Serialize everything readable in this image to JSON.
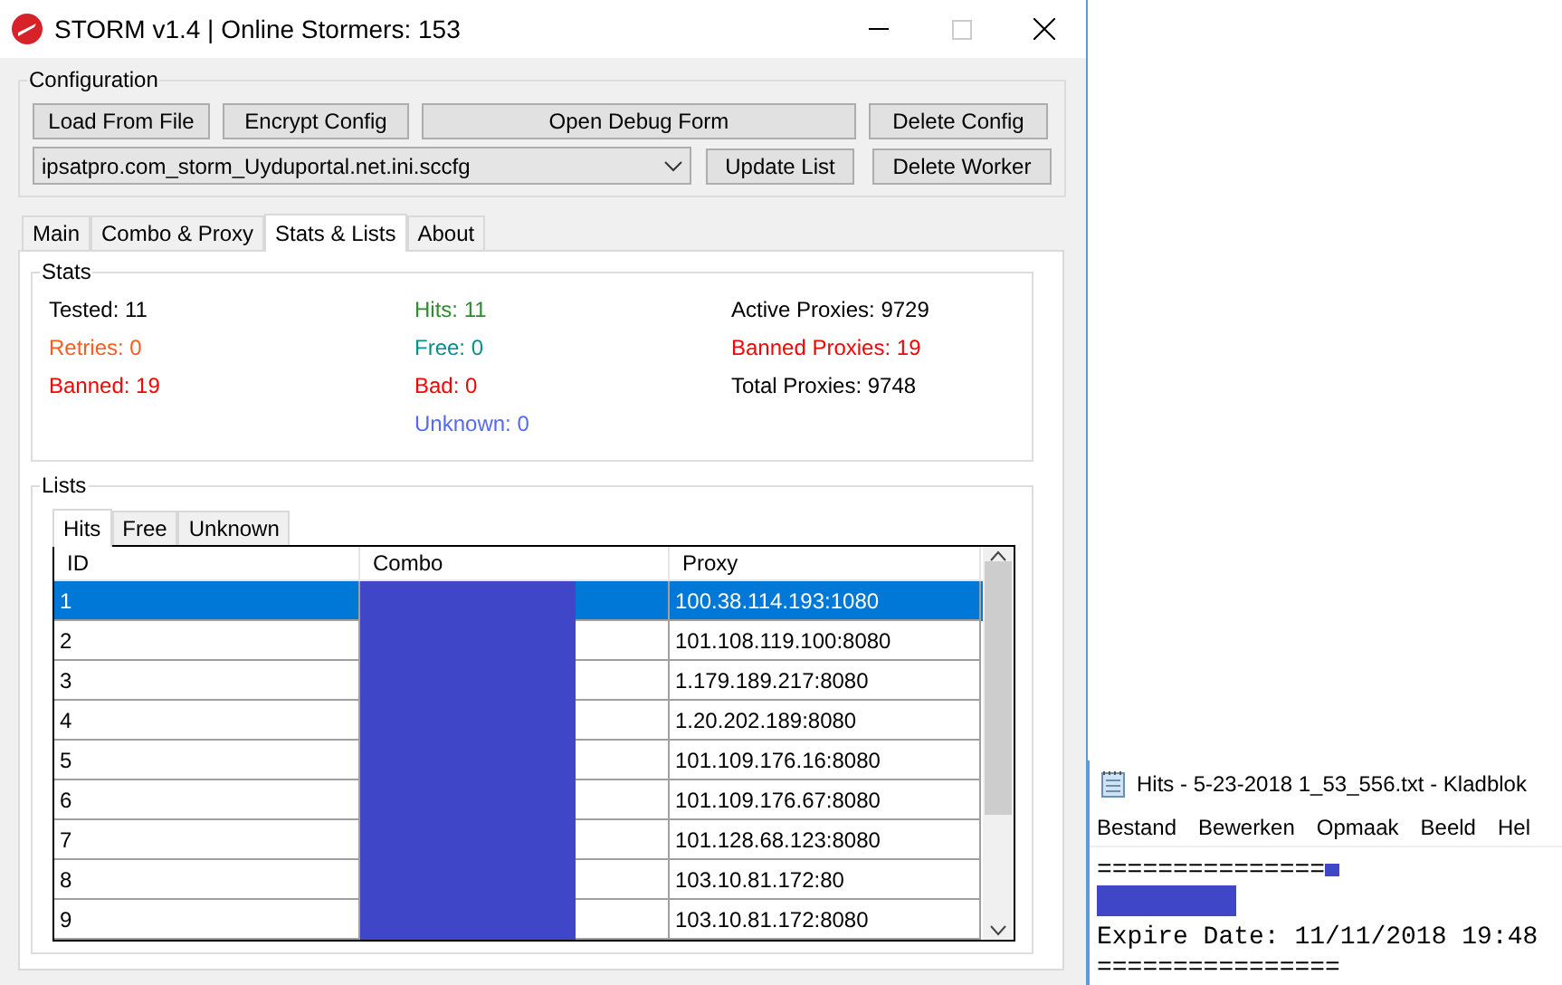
{
  "window": {
    "title": "STORM v1.4 | Online Stormers: 153"
  },
  "configuration": {
    "title": "Configuration",
    "buttons_row1": [
      "Load From File",
      "Encrypt Config",
      "Open Debug Form",
      "Delete Config"
    ],
    "config_select": "ipsatpro.com_storm_Uyduportal.net.ini.sccfg",
    "buttons_row2": [
      "Update List",
      "Delete Worker"
    ]
  },
  "tabs": [
    {
      "label": "Main",
      "selected": false
    },
    {
      "label": "Combo & Proxy",
      "selected": false
    },
    {
      "label": "Stats & Lists",
      "selected": true
    },
    {
      "label": "About",
      "selected": false
    }
  ],
  "stats": {
    "title": "Stats",
    "columns": [
      [
        {
          "text": "Tested: 11",
          "color": "#000000"
        },
        {
          "text": "Retries: 0",
          "color": "#ff5a1f"
        },
        {
          "text": "Banned: 19",
          "color": "#ff0000"
        }
      ],
      [
        {
          "text": "Hits: 11",
          "color": "#2e8b2e"
        },
        {
          "text": "Free: 0",
          "color": "#009090"
        },
        {
          "text": "Bad: 0",
          "color": "#ff0000"
        },
        {
          "text": "Unknown: 0",
          "color": "#5468ff"
        }
      ],
      [
        {
          "text": "Active Proxies: 9729",
          "color": "#000000"
        },
        {
          "text": "Banned Proxies: 19",
          "color": "#ff0000"
        },
        {
          "text": "Total Proxies: 9748",
          "color": "#000000"
        }
      ]
    ]
  },
  "lists": {
    "title": "Lists",
    "tabs": [
      {
        "label": "Hits",
        "selected": true
      },
      {
        "label": "Free",
        "selected": false
      },
      {
        "label": "Unknown",
        "selected": false
      }
    ],
    "columns": [
      "ID",
      "Combo",
      "Proxy"
    ],
    "rows": [
      {
        "id": "1",
        "proxy": "100.38.114.193:1080",
        "selected": true
      },
      {
        "id": "2",
        "proxy": "101.108.119.100:8080",
        "selected": false
      },
      {
        "id": "3",
        "proxy": "1.179.189.217:8080",
        "selected": false
      },
      {
        "id": "4",
        "proxy": "1.20.202.189:8080",
        "selected": false
      },
      {
        "id": "5",
        "proxy": "101.109.176.16:8080",
        "selected": false
      },
      {
        "id": "6",
        "proxy": "101.109.176.67:8080",
        "selected": false
      },
      {
        "id": "7",
        "proxy": "101.128.68.123:8080",
        "selected": false
      },
      {
        "id": "8",
        "proxy": "103.10.81.172:80",
        "selected": false
      },
      {
        "id": "9",
        "proxy": "103.10.81.172:8080",
        "selected": false
      }
    ]
  },
  "notepad": {
    "title": "Hits - 5-23-2018 1_53_556.txt - Kladblok",
    "menu": [
      "Bestand",
      "Bewerken",
      "Opmaak",
      "Beeld",
      "Hel"
    ],
    "lines": [
      {
        "kind": "rule",
        "text": "===============",
        "redacted_tail": true
      },
      {
        "kind": "redacted"
      },
      {
        "kind": "text",
        "text": "Expire Date: 11/11/2018 19:48"
      },
      {
        "kind": "rule",
        "text": "================",
        "redacted_tail": false
      }
    ]
  }
}
